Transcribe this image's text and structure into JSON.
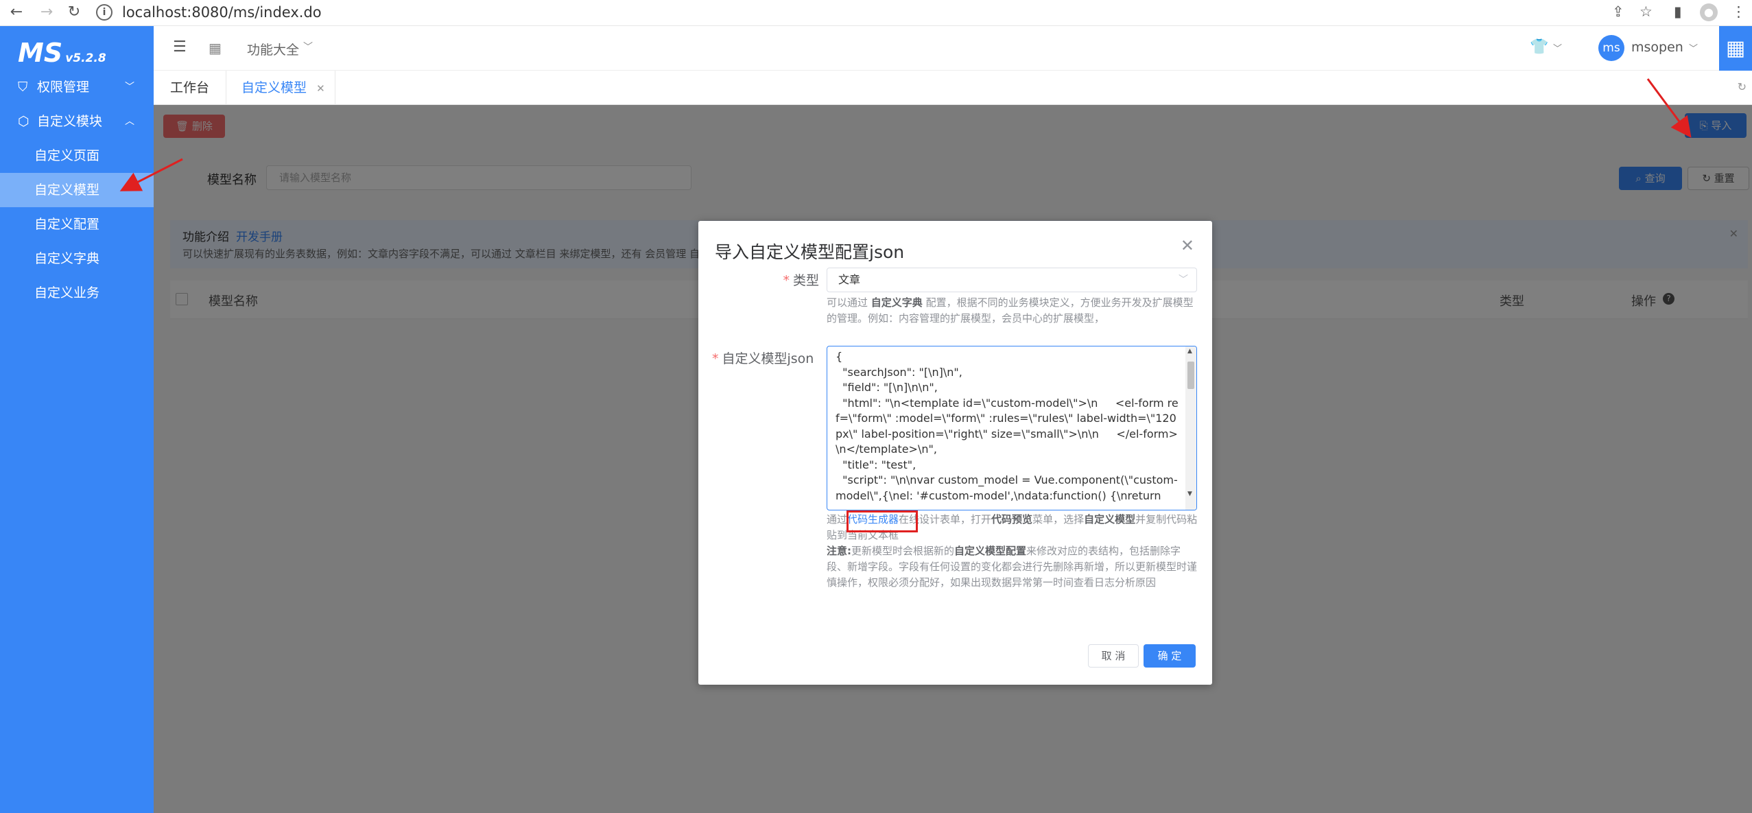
{
  "browser": {
    "url": "localhost:8080/ms/index.do"
  },
  "sidebar": {
    "logo": "MS",
    "version": "v5.2.8",
    "groups": [
      {
        "label": "权限管理",
        "icon": "shield-icon",
        "expanded": false
      },
      {
        "label": "自定义模块",
        "icon": "cube-icon",
        "expanded": true
      }
    ],
    "subitems": [
      {
        "label": "自定义页面",
        "active": false
      },
      {
        "label": "自定义模型",
        "active": true
      },
      {
        "label": "自定义配置",
        "active": false
      },
      {
        "label": "自定义字典",
        "active": false
      },
      {
        "label": "自定义业务",
        "active": false
      }
    ]
  },
  "topbar": {
    "menu_label": "功能大全",
    "username": "msopen",
    "avatar_text": "ms"
  },
  "tabs": [
    {
      "label": "工作台",
      "active": false
    },
    {
      "label": "自定义模型",
      "active": true,
      "closable": true
    }
  ],
  "page": {
    "delete_label": "删除",
    "import_label": "导入",
    "filter_label": "模型名称",
    "filter_placeholder": "请输入模型名称",
    "query_label": "查询",
    "reset_label": "重置",
    "intro_title": "功能介绍",
    "intro_link": "开发手册",
    "intro_text": "可以快速扩展现有的业务表数据，例如：文章内容字段不满足，可以通过 文章栏目 来绑定模型，还有 会员管理 自",
    "col_name": "模型名称",
    "col_type": "类型",
    "col_ops": "操作"
  },
  "modal": {
    "title": "导入自定义模型配置json",
    "type_label": "类型",
    "type_value": "文章",
    "type_help_1": "可以通过",
    "type_help_bold": "自定义字典",
    "type_help_2": "配置，根据不同的业务模块定义，方便业务开发及扩展模型的管理。例如：内容管理的扩展模型，会员中心的扩展模型，",
    "json_label": "自定义模型json",
    "json_value": "{\n  \"searchJson\": \"[\\n]\\n\",\n  \"field\": \"[\\n]\\n\\n\",\n  \"html\": \"\\n<template id=\\\"custom-model\\\">\\n     <el-form ref=\\\"form\\\" :model=\\\"form\\\" :rules=\\\"rules\\\" label-width=\\\"120px\\\" label-position=\\\"right\\\" size=\\\"small\\\">\\n\\n     </el-form>\\n</template>\\n\",\n  \"title\": \"test\",\n  \"script\": \"\\n\\nvar custom_model = Vue.component(\\\"custom-model\\\",{\\nel: '#custom-model',\\ndata:function() {\\nreturn",
    "hint_1": "通过",
    "hint_link": "代码生成器",
    "hint_2": "在线设计表单，打开",
    "hint_bold_1": "代码预览",
    "hint_3": "菜单，选择",
    "hint_bold_2": "自定义模型",
    "hint_4": "并复制代码粘贴到当前文本框",
    "note_bold": "注意:",
    "note_1": "更新模型时会根据新的",
    "note_bold_2": "自定义模型配置",
    "note_2": "来修改对应的表结构，包括删除字段、新增字段。字段有任何设置的变化都会进行先删除再新增，所以更新模型时谨慎操作，权限必须分配好，如果出现数据异常第一时间查看日志分析原因",
    "cancel_label": "取 消",
    "confirm_label": "确 定"
  },
  "colors": {
    "primary": "#3886f6",
    "danger": "#f56c6c",
    "annotation": "#e02020"
  }
}
